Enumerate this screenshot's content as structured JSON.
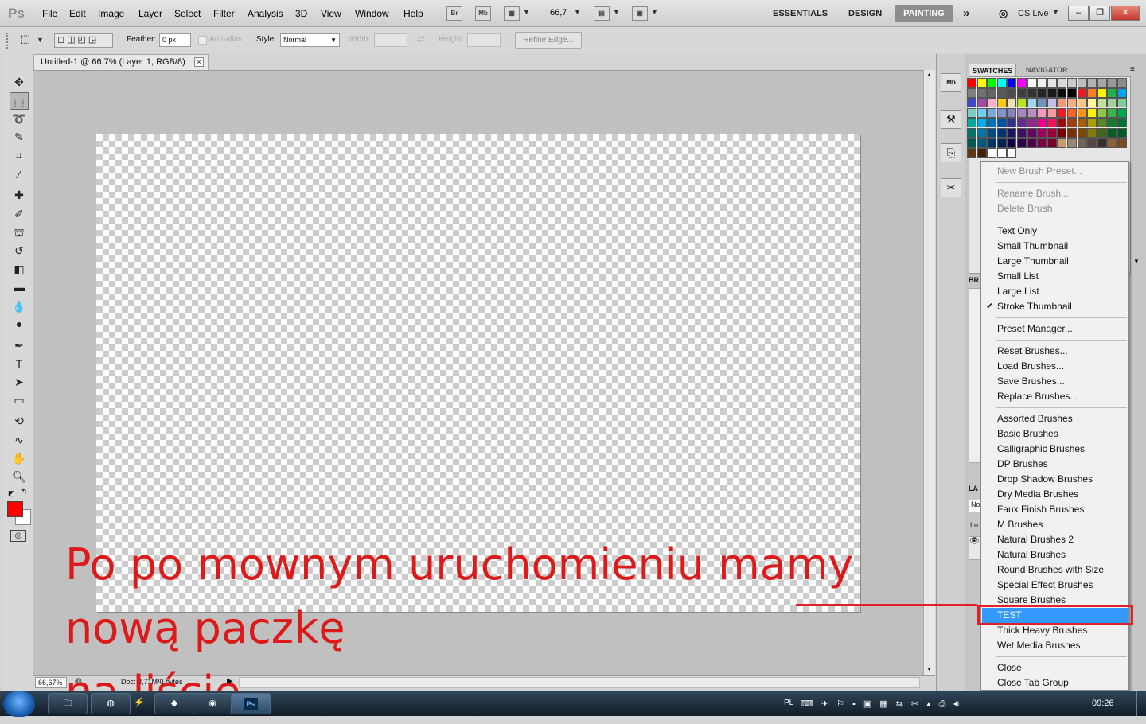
{
  "app": {
    "logo": "Ps"
  },
  "menubar": {
    "items": [
      "File",
      "Edit",
      "Image",
      "Layer",
      "Select",
      "Filter",
      "Analysis",
      "3D",
      "View",
      "Window",
      "Help"
    ],
    "bridge": "Br",
    "mini_bridge": "Mb",
    "zoom_value": "66,7",
    "workspaces": {
      "essentials": "ESSENTIALS",
      "design": "DESIGN",
      "painting": "PAINTING",
      "more": "»"
    },
    "cs_live": "CS Live"
  },
  "options": {
    "feather_label": "Feather:",
    "feather_value": "0 px",
    "anti_alias": "Anti-alias",
    "style_label": "Style:",
    "style_value": "Normal",
    "width_label": "Width:",
    "height_label": "Height:",
    "refine_edge": "Refine Edge..."
  },
  "document": {
    "tab_title": "Untitled-1 @ 66,7% (Layer 1, RGB/8)",
    "close": "×",
    "zoom_status": "66,67%",
    "doc_info": "Doc: 3,71M/0 bytes"
  },
  "annotation": {
    "line1": "Po po mownym uruchomieniu mamy nową paczkę",
    "line2": "na liście."
  },
  "panels": {
    "swatches_tab": "SWATCHES",
    "navigator_tab": "NAVIGATOR",
    "brush_tab": "BR",
    "layers_tab": "LA",
    "layers_mode": "No",
    "layers_lock": "Lo"
  },
  "swatch_colors": [
    "#ff0000",
    "#ffff00",
    "#00ff00",
    "#00ffff",
    "#0000ff",
    "#ff00ff",
    "#ffffff",
    "#f2f2f2",
    "#e5e5e5",
    "#d8d8d8",
    "#cccccc",
    "#bfbfbf",
    "#b2b2b2",
    "#a5a5a5",
    "#999999",
    "#8c8c8c",
    "#7f7f7f",
    "#727272",
    "#666666",
    "#595959",
    "#4c4c4c",
    "#3f3f3f",
    "#333333",
    "#262626",
    "#191919",
    "#0c0c0c",
    "#000000",
    "#ed1c24",
    "#ff7f27",
    "#fff200",
    "#22b14c",
    "#00a2e8",
    "#3f48cc",
    "#a349a4",
    "#ffaec9",
    "#ffc90e",
    "#efe4b0",
    "#b5e61d",
    "#99d9ea",
    "#7092be",
    "#c8bfe7",
    "#f7977a",
    "#f9ad81",
    "#fdc68a",
    "#fff79a",
    "#c4df9b",
    "#a2d39c",
    "#82ca9d",
    "#7bcdc8",
    "#6ecff6",
    "#7ea7d8",
    "#8493ca",
    "#8882be",
    "#a187be",
    "#bc8dbf",
    "#f49ac2",
    "#f6989d",
    "#ed1c24",
    "#f26522",
    "#f7941d",
    "#fff200",
    "#8dc63f",
    "#39b54a",
    "#00a651",
    "#00a99d",
    "#00aeef",
    "#0072bc",
    "#0054a6",
    "#2e3192",
    "#662d91",
    "#92278f",
    "#ec008c",
    "#ed145b",
    "#9e0b0f",
    "#a0410d",
    "#a3620a",
    "#aba000",
    "#598527",
    "#1a7b30",
    "#007236",
    "#00746b",
    "#0076a3",
    "#004b80",
    "#003471",
    "#1b1464",
    "#440e62",
    "#630460",
    "#9e005d",
    "#9e0039",
    "#790000",
    "#7b2e00",
    "#7d4900",
    "#827b00",
    "#406618",
    "#005e20",
    "#005826",
    "#005952",
    "#005b7f",
    "#003663",
    "#002157",
    "#0d004c",
    "#32004b",
    "#4b0049",
    "#7b0046",
    "#7a0026",
    "#c69c6d",
    "#998675",
    "#736357",
    "#534741",
    "#362f2d",
    "#8c6239",
    "#754c24",
    "#603913",
    "#42210b",
    "#ffffff",
    "#ffffff",
    "#ffffff"
  ],
  "brush_menu": {
    "items": [
      {
        "label": "New Brush Preset...",
        "disabled": true
      },
      {
        "label": "Rename Brush...",
        "disabled": true
      },
      {
        "label": "Delete Brush",
        "disabled": true
      },
      {
        "label": "Text Only"
      },
      {
        "label": "Small Thumbnail"
      },
      {
        "label": "Large Thumbnail"
      },
      {
        "label": "Small List"
      },
      {
        "label": "Large List"
      },
      {
        "label": "Stroke Thumbnail",
        "checked": true
      },
      {
        "label": "Preset Manager..."
      },
      {
        "label": "Reset Brushes..."
      },
      {
        "label": "Load Brushes..."
      },
      {
        "label": "Save Brushes..."
      },
      {
        "label": "Replace Brushes..."
      },
      {
        "label": "Assorted Brushes"
      },
      {
        "label": "Basic Brushes"
      },
      {
        "label": "Calligraphic Brushes"
      },
      {
        "label": "DP Brushes"
      },
      {
        "label": "Drop Shadow Brushes"
      },
      {
        "label": "Dry Media Brushes"
      },
      {
        "label": "Faux Finish Brushes"
      },
      {
        "label": "M Brushes"
      },
      {
        "label": "Natural Brushes 2"
      },
      {
        "label": "Natural Brushes"
      },
      {
        "label": "Round Brushes with Size"
      },
      {
        "label": "Special Effect Brushes"
      },
      {
        "label": "Square Brushes"
      },
      {
        "label": "TEST",
        "highlighted": true
      },
      {
        "label": "Thick Heavy Brushes"
      },
      {
        "label": "Wet Media Brushes"
      },
      {
        "label": "Close"
      },
      {
        "label": "Close Tab Group"
      }
    ]
  },
  "colors": {
    "foreground": "#ff0000",
    "background": "#ffffff",
    "menu_highlight": "#3399ff",
    "annotation": "#dd1a1a"
  },
  "taskbar": {
    "lang": "PL",
    "clock": "09:26",
    "ps_label": "Ps"
  }
}
